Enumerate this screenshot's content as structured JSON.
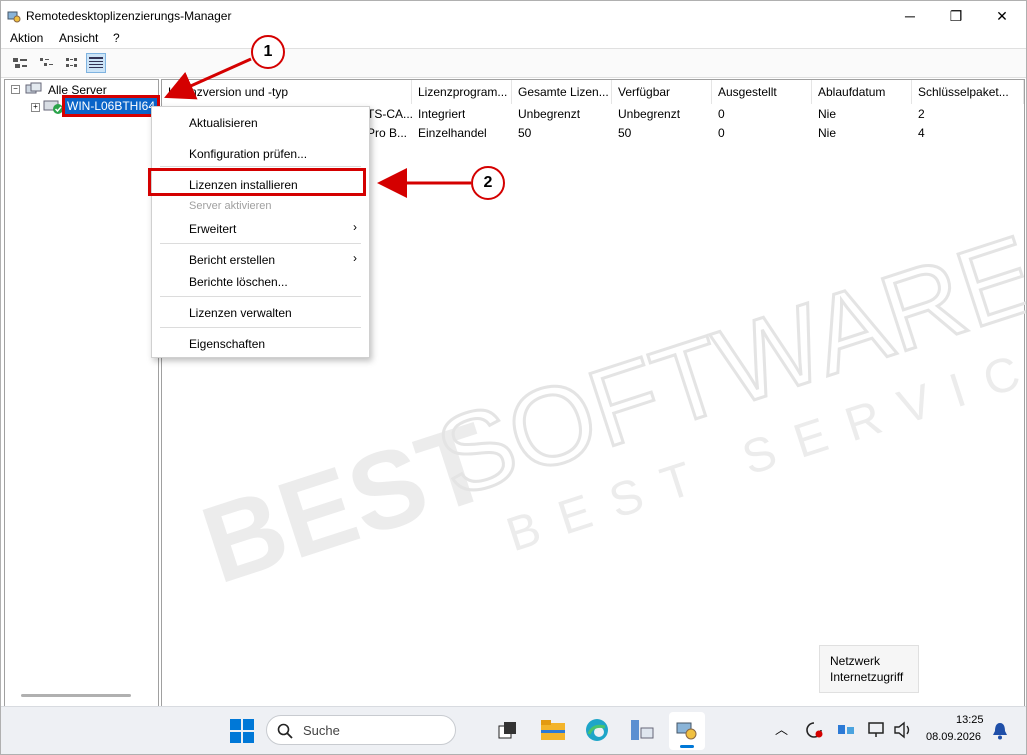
{
  "window": {
    "title": "Remotedesktoplizenzierungs-Manager",
    "minimize": "─",
    "maximize": "❐",
    "close": "✕"
  },
  "menu": {
    "items": [
      "Aktion",
      "Ansicht",
      "?"
    ]
  },
  "tree": {
    "root": "Alle Server",
    "server": "WIN-L06BTHI64"
  },
  "columns": [
    "Lizenzversion und -typ",
    "Lizenzprogram...",
    "Gesamte Lizen...",
    "Verfügbar",
    "Ausgestellt",
    "Ablaufdatum",
    "Schlüsselpaket..."
  ],
  "rows": [
    [
      "TS-CA...",
      "Integriert",
      "Unbegrenzt",
      "Unbegrenzt",
      "0",
      "Nie",
      "2"
    ],
    [
      "Pro B...",
      "Einzelhandel",
      "50",
      "50",
      "0",
      "Nie",
      "4"
    ]
  ],
  "context_menu": {
    "refresh": "Aktualisieren",
    "check_config": "Konfiguration prüfen...",
    "install_licenses": "Lizenzen installieren",
    "activate_server": "Server aktivieren",
    "advanced": "Erweitert",
    "create_report": "Bericht erstellen",
    "delete_reports": "Berichte löschen...",
    "manage_licenses": "Lizenzen verwalten",
    "properties": "Eigenschaften"
  },
  "callouts": {
    "one": "1",
    "two": "2"
  },
  "toast": {
    "line1": "Netzwerk",
    "line2": "Internetzugriff"
  },
  "taskbar": {
    "search_placeholder": "Suche",
    "time": "13:25",
    "date": "08.09.2026"
  },
  "watermark": {
    "brand": "BEST",
    "brand2": "SOFTWARE",
    "tagline": "BEST SERVICE"
  },
  "colors": {
    "accent": "#0078d7",
    "callout_red": "#d40000",
    "selection": "#0a64c8"
  }
}
